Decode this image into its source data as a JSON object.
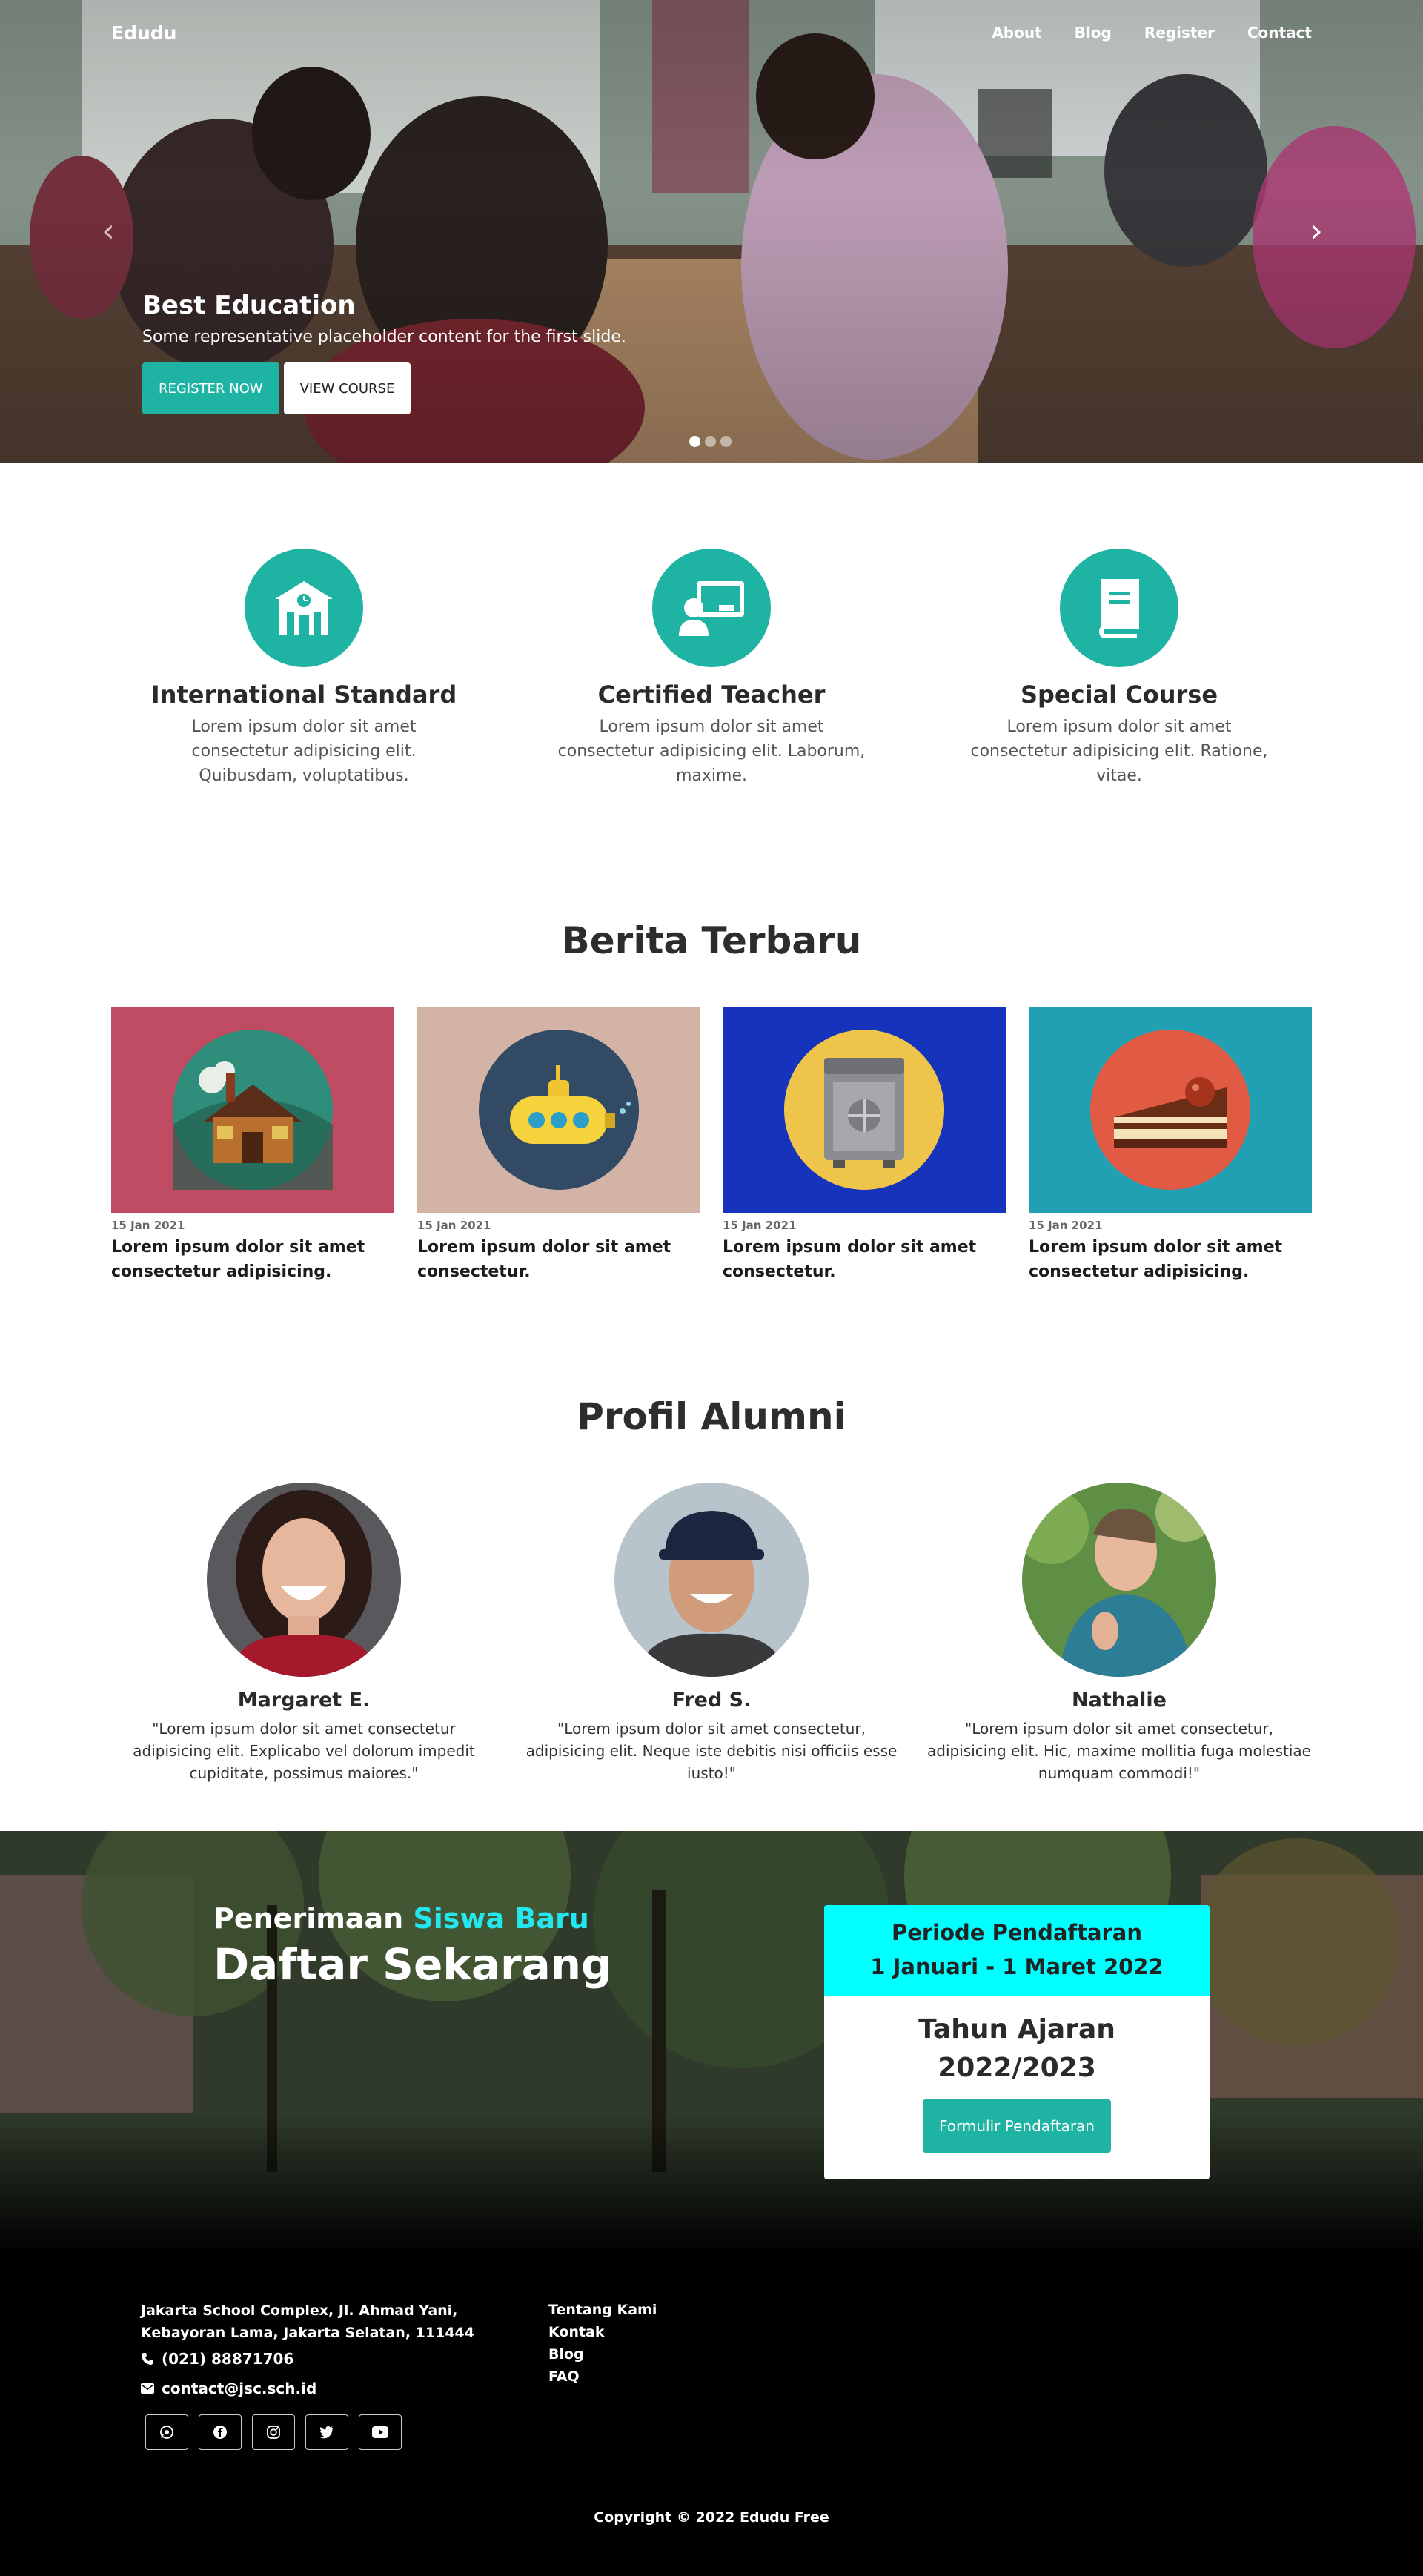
{
  "nav": {
    "brand": "Edudu",
    "items": [
      "About",
      "Blog",
      "Register",
      "Contact"
    ]
  },
  "hero": {
    "title": "Best Education",
    "subtitle": "Some representative placeholder content for the first slide.",
    "register_label": "REGISTER NOW",
    "course_label": "VIEW COURSE",
    "slides": 3,
    "active_slide": 1
  },
  "features": [
    {
      "icon": "school-icon",
      "title": "International Standard",
      "text": "Lorem ipsum dolor sit amet consectetur adipisicing elit. Quibusdam, voluptatibus."
    },
    {
      "icon": "teacher-icon",
      "title": "Certified Teacher",
      "text": "Lorem ipsum dolor sit amet consectetur adipisicing elit. Laborum, maxime."
    },
    {
      "icon": "book-icon",
      "title": "Special Course",
      "text": "Lorem ipsum dolor sit amet consectetur adipisicing elit. Ratione, vitae."
    }
  ],
  "news": {
    "heading": "Berita Terbaru",
    "items": [
      {
        "date": "15 Jan 2021",
        "title": "Lorem ipsum dolor sit amet consectetur adipisicing.",
        "bg": "#c04c63",
        "icon": "cabin-icon"
      },
      {
        "date": "15 Jan 2021",
        "title": "Lorem ipsum dolor sit amet consectetur.",
        "bg": "#d3b3a6",
        "icon": "submarine-icon"
      },
      {
        "date": "15 Jan 2021",
        "title": "Lorem ipsum dolor sit amet consectetur.",
        "bg": "#1533bb",
        "icon": "safe-icon"
      },
      {
        "date": "15 Jan 2021",
        "title": "Lorem ipsum dolor sit amet consectetur adipisicing.",
        "bg": "#21a0b4",
        "icon": "cake-icon"
      }
    ]
  },
  "alumni": {
    "heading": "Profil Alumni",
    "items": [
      {
        "name": "Margaret E.",
        "quote": "\"Lorem ipsum dolor sit amet consectetur adipisicing elit. Explicabo vel dolorum impedit cupiditate, possimus maiores.\""
      },
      {
        "name": "Fred S.",
        "quote": "\"Lorem ipsum dolor sit amet consectetur, adipisicing elit. Neque iste debitis nisi officiis esse iusto!\""
      },
      {
        "name": "Nathalie",
        "quote": "\"Lorem ipsum dolor sit amet consectetur, adipisicing elit. Hic, maxime mollitia fuga molestiae numquam commodi!\""
      }
    ]
  },
  "registration": {
    "sub_prefix": "Penerimaan",
    "sub_highlight": "Siswa Baru",
    "main": "Daftar Sekarang",
    "period_label": "Periode Pendaftaran",
    "period_dates": "1 Januari - 1 Maret 2022",
    "year_label": "Tahun Ajaran",
    "year_value": "2022/2023",
    "form_button": "Formulir Pendaftaran",
    "highlight_color": "#23e6ef"
  },
  "footer": {
    "address_line1": "Jakarta School Complex, Jl. Ahmad Yani,",
    "address_line2": "Kebayoran Lama, Jakarta Selatan, 111444",
    "phone": "(021) 88871706",
    "email": "contact@jsc.sch.id",
    "social": [
      "whatsapp-icon",
      "facebook-icon",
      "instagram-icon",
      "twitter-icon",
      "youtube-icon"
    ],
    "links": [
      "Tentang Kami",
      "Kontak",
      "Blog",
      "FAQ"
    ],
    "copyright": "Copyright © 2022 Edudu Free"
  },
  "colors": {
    "accent": "#1eb3a3",
    "cyan": "#00ffff"
  }
}
